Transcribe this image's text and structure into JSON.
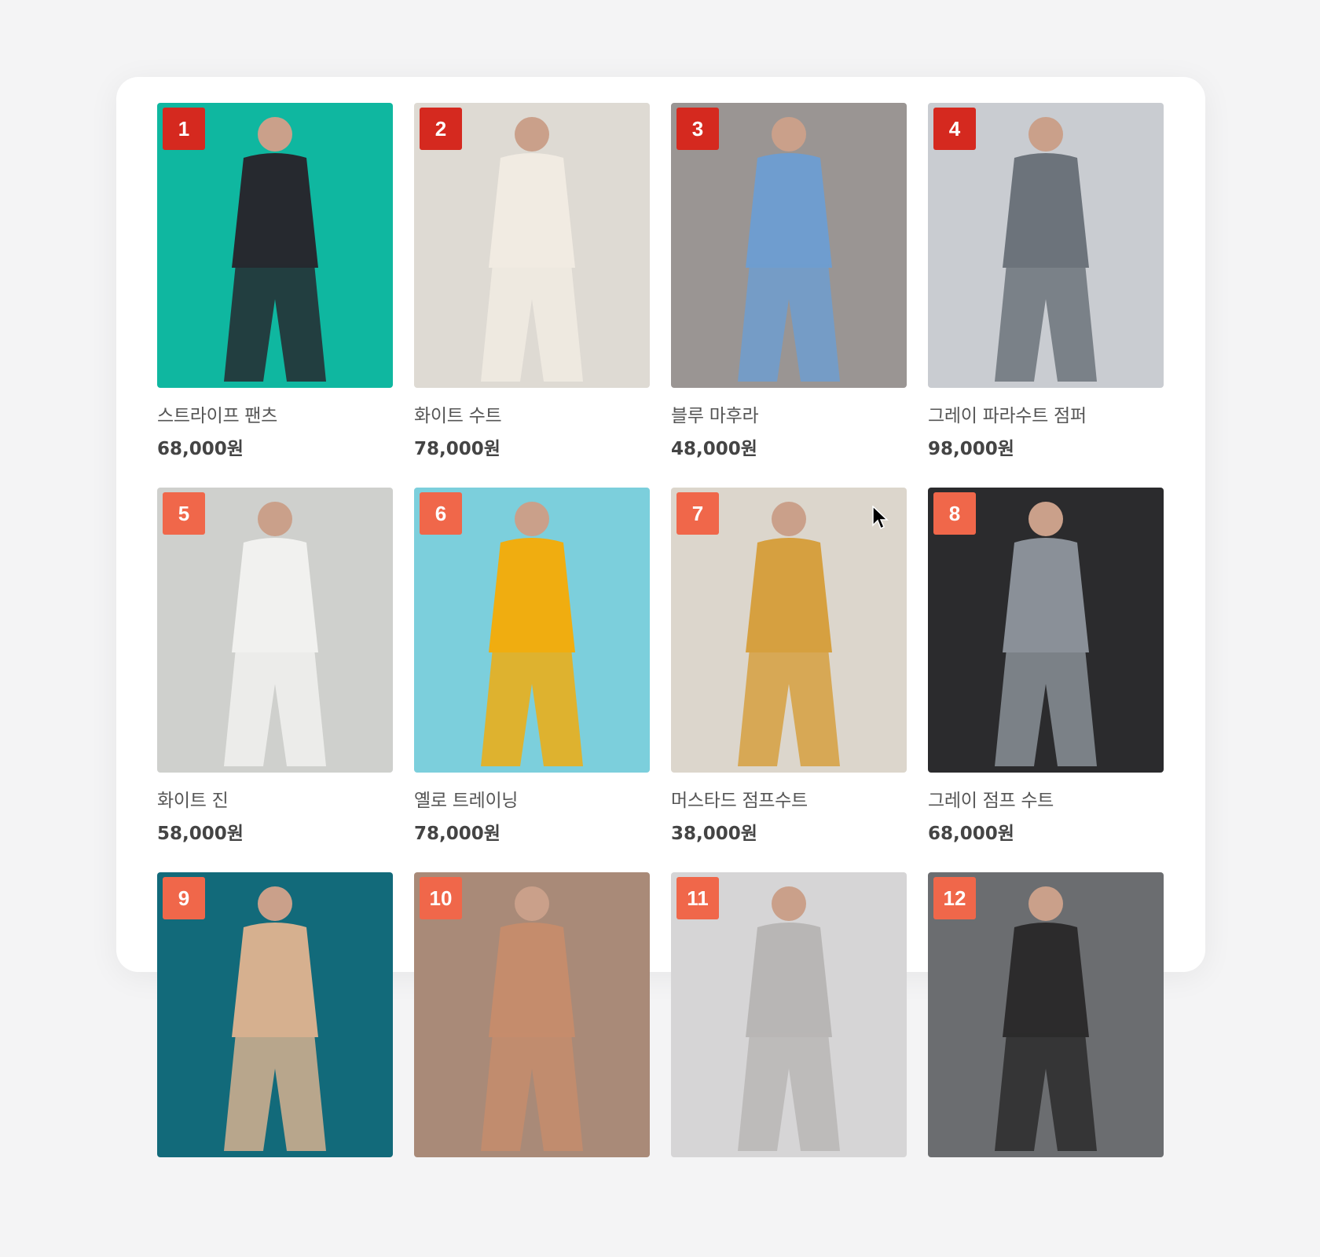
{
  "products": [
    {
      "rank": "1",
      "name": "스트라이프 팬츠",
      "price": "68,000원",
      "bg": "#0fb7a0",
      "fg": "#26292f"
    },
    {
      "rank": "2",
      "name": "화이트 수트",
      "price": "78,000원",
      "bg": "#dedad3",
      "fg": "#f1ebe2"
    },
    {
      "rank": "3",
      "name": "블루 마후라",
      "price": "48,000원",
      "bg": "#9a9593",
      "fg": "#6f9dcf"
    },
    {
      "rank": "4",
      "name": "그레이 파라수트 점퍼",
      "price": "98,000원",
      "bg": "#c9ccd1",
      "fg": "#6c737b"
    },
    {
      "rank": "5",
      "name": "화이트 진",
      "price": "58,000원",
      "bg": "#cfd0cd",
      "fg": "#f1f1ef"
    },
    {
      "rank": "6",
      "name": "옐로 트레이닝",
      "price": "78,000원",
      "bg": "#7ccfdc",
      "fg": "#f0ad10"
    },
    {
      "rank": "7",
      "name": "머스타드 점프수트",
      "price": "38,000원",
      "bg": "#dcd6cc",
      "fg": "#d6a040"
    },
    {
      "rank": "8",
      "name": "그레이 점프 수트",
      "price": "68,000원",
      "bg": "#2b2b2d",
      "fg": "#8a9098"
    },
    {
      "rank": "9",
      "name": "",
      "price": "",
      "bg": "#126a7a",
      "fg": "#d6b08f"
    },
    {
      "rank": "10",
      "name": "",
      "price": "",
      "bg": "#a98a78",
      "fg": "#c58c6c"
    },
    {
      "rank": "11",
      "name": "",
      "price": "",
      "bg": "#d6d5d6",
      "fg": "#b8b6b5"
    },
    {
      "rank": "12",
      "name": "",
      "price": "",
      "bg": "#6b6d70",
      "fg": "#2c2b2c"
    }
  ]
}
